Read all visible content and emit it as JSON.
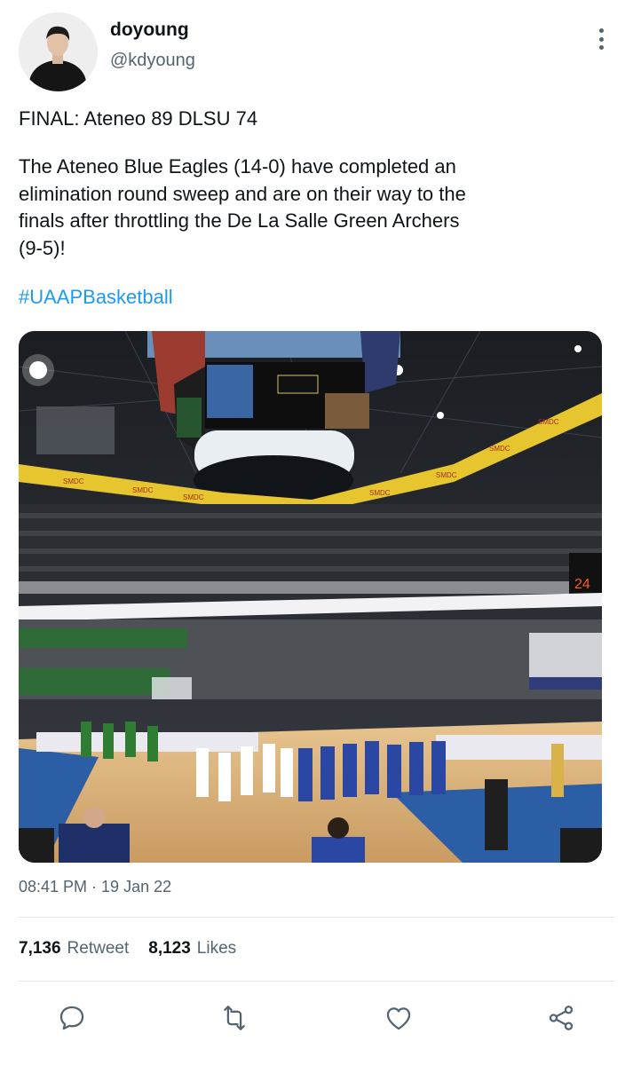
{
  "user": {
    "display_name": "doyoung",
    "handle": "@kdyoung"
  },
  "tweet": {
    "line1": "FINAL: Ateneo 89 DLSU 74",
    "body": "The Ateneo Blue Eagles (14-0) have completed an\nelimination round sweep and are on their way to the\nfinals after throttling the De La Salle Green Archers\n(9-5)!",
    "hashtag": "#UAAPBasketball",
    "timestamp": "08:41 PM · 19 Jan 22"
  },
  "stats": {
    "retweets": "7,136",
    "retweets_label": "Retweet",
    "likes": "8,123",
    "likes_label": "Likes"
  },
  "actions": [
    "reply-icon",
    "retweet-icon",
    "like-icon",
    "share-icon"
  ],
  "colors": {
    "text": "#0f1419",
    "secondary": "#536471",
    "accent": "#1d9bf0"
  }
}
